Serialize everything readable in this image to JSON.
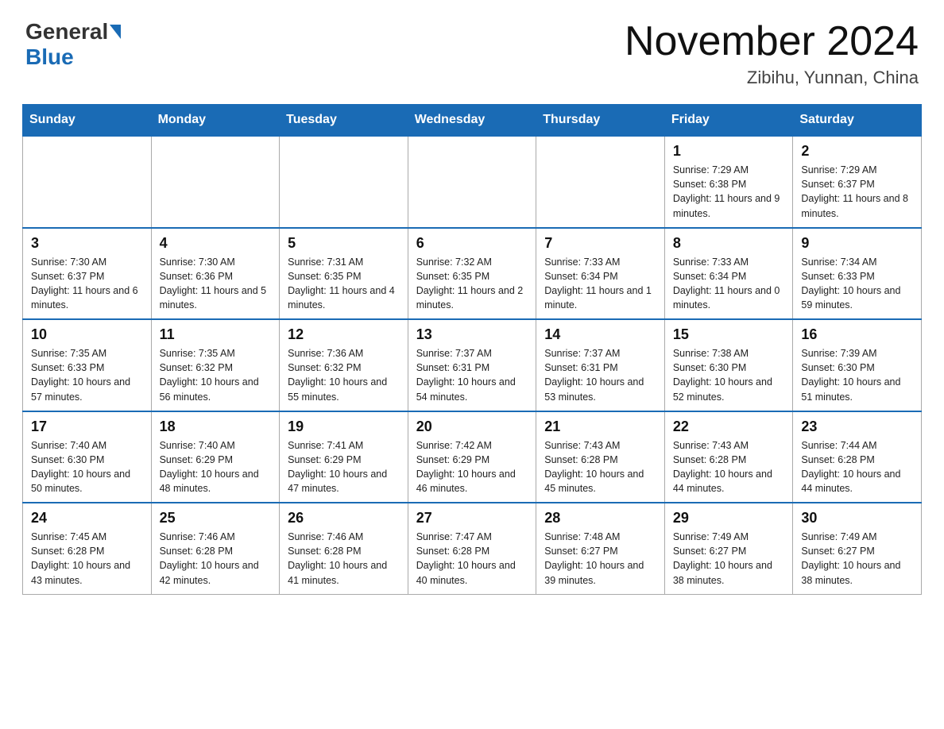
{
  "header": {
    "logo_text_general": "General",
    "logo_text_blue": "Blue",
    "month_year": "November 2024",
    "location": "Zibihu, Yunnan, China"
  },
  "weekdays": [
    "Sunday",
    "Monday",
    "Tuesday",
    "Wednesday",
    "Thursday",
    "Friday",
    "Saturday"
  ],
  "weeks": [
    [
      {
        "day": "",
        "info": ""
      },
      {
        "day": "",
        "info": ""
      },
      {
        "day": "",
        "info": ""
      },
      {
        "day": "",
        "info": ""
      },
      {
        "day": "",
        "info": ""
      },
      {
        "day": "1",
        "info": "Sunrise: 7:29 AM\nSunset: 6:38 PM\nDaylight: 11 hours and 9 minutes."
      },
      {
        "day": "2",
        "info": "Sunrise: 7:29 AM\nSunset: 6:37 PM\nDaylight: 11 hours and 8 minutes."
      }
    ],
    [
      {
        "day": "3",
        "info": "Sunrise: 7:30 AM\nSunset: 6:37 PM\nDaylight: 11 hours and 6 minutes."
      },
      {
        "day": "4",
        "info": "Sunrise: 7:30 AM\nSunset: 6:36 PM\nDaylight: 11 hours and 5 minutes."
      },
      {
        "day": "5",
        "info": "Sunrise: 7:31 AM\nSunset: 6:35 PM\nDaylight: 11 hours and 4 minutes."
      },
      {
        "day": "6",
        "info": "Sunrise: 7:32 AM\nSunset: 6:35 PM\nDaylight: 11 hours and 2 minutes."
      },
      {
        "day": "7",
        "info": "Sunrise: 7:33 AM\nSunset: 6:34 PM\nDaylight: 11 hours and 1 minute."
      },
      {
        "day": "8",
        "info": "Sunrise: 7:33 AM\nSunset: 6:34 PM\nDaylight: 11 hours and 0 minutes."
      },
      {
        "day": "9",
        "info": "Sunrise: 7:34 AM\nSunset: 6:33 PM\nDaylight: 10 hours and 59 minutes."
      }
    ],
    [
      {
        "day": "10",
        "info": "Sunrise: 7:35 AM\nSunset: 6:33 PM\nDaylight: 10 hours and 57 minutes."
      },
      {
        "day": "11",
        "info": "Sunrise: 7:35 AM\nSunset: 6:32 PM\nDaylight: 10 hours and 56 minutes."
      },
      {
        "day": "12",
        "info": "Sunrise: 7:36 AM\nSunset: 6:32 PM\nDaylight: 10 hours and 55 minutes."
      },
      {
        "day": "13",
        "info": "Sunrise: 7:37 AM\nSunset: 6:31 PM\nDaylight: 10 hours and 54 minutes."
      },
      {
        "day": "14",
        "info": "Sunrise: 7:37 AM\nSunset: 6:31 PM\nDaylight: 10 hours and 53 minutes."
      },
      {
        "day": "15",
        "info": "Sunrise: 7:38 AM\nSunset: 6:30 PM\nDaylight: 10 hours and 52 minutes."
      },
      {
        "day": "16",
        "info": "Sunrise: 7:39 AM\nSunset: 6:30 PM\nDaylight: 10 hours and 51 minutes."
      }
    ],
    [
      {
        "day": "17",
        "info": "Sunrise: 7:40 AM\nSunset: 6:30 PM\nDaylight: 10 hours and 50 minutes."
      },
      {
        "day": "18",
        "info": "Sunrise: 7:40 AM\nSunset: 6:29 PM\nDaylight: 10 hours and 48 minutes."
      },
      {
        "day": "19",
        "info": "Sunrise: 7:41 AM\nSunset: 6:29 PM\nDaylight: 10 hours and 47 minutes."
      },
      {
        "day": "20",
        "info": "Sunrise: 7:42 AM\nSunset: 6:29 PM\nDaylight: 10 hours and 46 minutes."
      },
      {
        "day": "21",
        "info": "Sunrise: 7:43 AM\nSunset: 6:28 PM\nDaylight: 10 hours and 45 minutes."
      },
      {
        "day": "22",
        "info": "Sunrise: 7:43 AM\nSunset: 6:28 PM\nDaylight: 10 hours and 44 minutes."
      },
      {
        "day": "23",
        "info": "Sunrise: 7:44 AM\nSunset: 6:28 PM\nDaylight: 10 hours and 44 minutes."
      }
    ],
    [
      {
        "day": "24",
        "info": "Sunrise: 7:45 AM\nSunset: 6:28 PM\nDaylight: 10 hours and 43 minutes."
      },
      {
        "day": "25",
        "info": "Sunrise: 7:46 AM\nSunset: 6:28 PM\nDaylight: 10 hours and 42 minutes."
      },
      {
        "day": "26",
        "info": "Sunrise: 7:46 AM\nSunset: 6:28 PM\nDaylight: 10 hours and 41 minutes."
      },
      {
        "day": "27",
        "info": "Sunrise: 7:47 AM\nSunset: 6:28 PM\nDaylight: 10 hours and 40 minutes."
      },
      {
        "day": "28",
        "info": "Sunrise: 7:48 AM\nSunset: 6:27 PM\nDaylight: 10 hours and 39 minutes."
      },
      {
        "day": "29",
        "info": "Sunrise: 7:49 AM\nSunset: 6:27 PM\nDaylight: 10 hours and 38 minutes."
      },
      {
        "day": "30",
        "info": "Sunrise: 7:49 AM\nSunset: 6:27 PM\nDaylight: 10 hours and 38 minutes."
      }
    ]
  ]
}
